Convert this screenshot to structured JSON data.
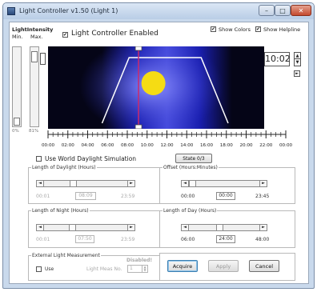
{
  "window": {
    "title": "Light Controller v1.50  (Light  1)",
    "minimize_glyph": "–",
    "maximize_glyph": "□",
    "close_glyph": "✕"
  },
  "header": {
    "light_intensity_label": "LightIntensity",
    "min_label": "Min.",
    "max_label": "Max.",
    "enabled_label": "Light Controller Enabled",
    "enabled_checked": true,
    "show_colors_label": "Show Colors",
    "show_colors_checked": true,
    "show_helpline_label": "Show Helpline",
    "show_helpline_checked": true
  },
  "intensity": {
    "min_value": 0.0,
    "max_value": 0.81,
    "channel": "1",
    "zero_label": "0%",
    "max_percent_label": "81%"
  },
  "graph": {
    "current_time": "10:02",
    "cursor_time_hours": 10.05,
    "daylight_start_hours": 6.0,
    "daylight_full_start_hours": 9.0,
    "daylight_full_end_hours": 17.0,
    "daylight_end_hours": 20.0,
    "sky_color": "#1a1fb0",
    "dark_color": "#050517",
    "sun_color": "#f5dc14",
    "cursor_color": "#cc2a6a"
  },
  "time_scale": {
    "labels": [
      "00:00",
      "02:00",
      "04:00",
      "06:00",
      "08:00",
      "10:00",
      "12:00",
      "14:00",
      "16:00",
      "18:00",
      "20:00",
      "22:00",
      "00:00"
    ]
  },
  "world_sim": {
    "label": "Use World Daylight Simulation",
    "checked": false,
    "state_button": "State 0/3"
  },
  "length_of_daylight": {
    "legend": "Length of Daylight (Hours)",
    "min": "00:01",
    "value": "08:09",
    "max": "23:59",
    "position": 0.34
  },
  "offset": {
    "legend": "Offset (Hours:Minutes)",
    "min": "00:00",
    "value": "00:00",
    "max": "23:45",
    "position": 0.0
  },
  "length_of_night": {
    "legend": "Length of Night (Hours)",
    "min": "00:01",
    "value": "07:50",
    "max": "23:59",
    "position": 0.33
  },
  "length_of_day": {
    "legend": "Length of Day (Hours)",
    "min": "06:00",
    "value": "24:00",
    "max": "48:00",
    "position": 0.43
  },
  "external": {
    "legend": "External Light Measurement",
    "use_label": "Use",
    "use_checked": false,
    "disabled_label": "Disabled!",
    "meas_label": "Light Meas No.",
    "meas_value": "1"
  },
  "buttons": {
    "acquire": "Acquire",
    "apply": "Apply",
    "cancel": "Cancel"
  }
}
